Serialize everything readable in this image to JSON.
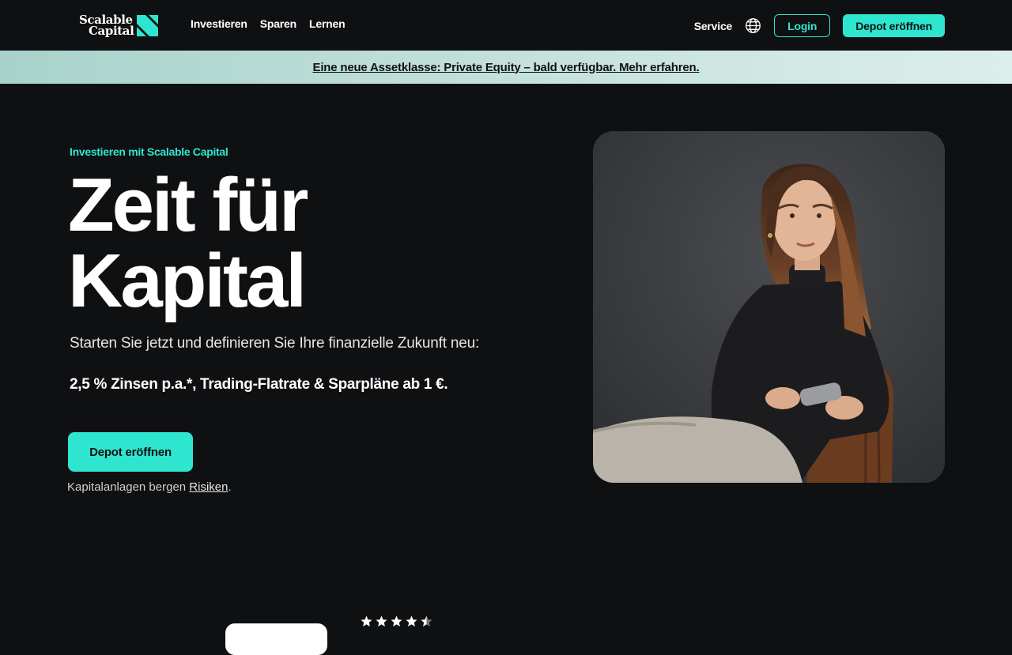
{
  "nav": {
    "logo": {
      "line1": "Scalable",
      "line2": "Capital"
    },
    "links": [
      "Investieren",
      "Sparen",
      "Lernen"
    ],
    "service": "Service",
    "login": "Login",
    "cta": "Depot eröffnen"
  },
  "banner": {
    "text": "Eine neue Assetklasse: Private Equity – bald verfügbar. Mehr erfahren."
  },
  "hero": {
    "eyebrow": "Investieren mit Scalable Capital",
    "headline_line1": "Zeit für",
    "headline_line2": "Kapital",
    "sub": "Starten Sie jetzt und definieren Sie Ihre finanzielle Zukunft neu:",
    "sub_strong": "2,5 % Zinsen p.a.*, Trading-Flatrate & Sparpläne ab 1 €.",
    "cta": "Depot eröffnen",
    "risk_prefix": "Kapitalanlagen bergen ",
    "risk_link": "Risiken",
    "risk_suffix": "."
  },
  "rating": {
    "stars": 4.5
  },
  "colors": {
    "accent": "#2ee6cf",
    "background": "#0f1012",
    "banner": "#c1dfda"
  },
  "icons": {
    "globe": "globe-icon",
    "star": "star-icon",
    "logo": "scalable-logo-mark"
  }
}
